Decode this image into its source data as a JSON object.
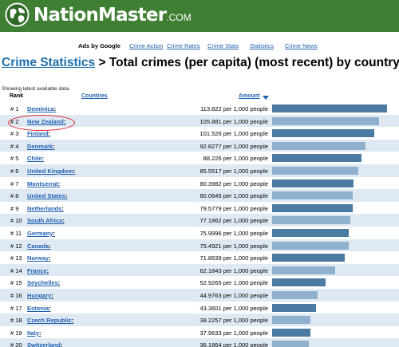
{
  "header": {
    "logo_main": "NationMaster",
    "logo_suffix": ".COM",
    "brand_color": "#3f7f33"
  },
  "adbar": {
    "ads_by": "Ads by Google",
    "links": [
      "Crime Action",
      "Crime Rates",
      "Crime Stats",
      "Statistics",
      "Crime News"
    ]
  },
  "page": {
    "breadcrumb": "Crime Statistics",
    "title": " > Total crimes (per capita) (most recent) by country",
    "showing": "Showing latest available data."
  },
  "table": {
    "headers": {
      "rank": "Rank",
      "countries": "Countries",
      "amount": "Amount"
    },
    "max_value": 113.822,
    "rows": [
      {
        "rank": "# 1",
        "country": "Dominica",
        "amount": "113.822 per 1,000 people",
        "value": 113.822
      },
      {
        "rank": "# 2",
        "country": "New Zealand",
        "amount": "105.881 per 1,000 people",
        "value": 105.881
      },
      {
        "rank": "# 3",
        "country": "Finland",
        "amount": "101.526 per 1,000 people",
        "value": 101.526
      },
      {
        "rank": "# 4",
        "country": "Denmark",
        "amount": "92.8277 per 1,000 people",
        "value": 92.8277
      },
      {
        "rank": "# 5",
        "country": "Chile",
        "amount": "88.226 per 1,000 people",
        "value": 88.226
      },
      {
        "rank": "# 6",
        "country": "United Kingdom",
        "amount": "85.5517 per 1,000 people",
        "value": 85.5517
      },
      {
        "rank": "# 7",
        "country": "Montserrat",
        "amount": "80.3982 per 1,000 people",
        "value": 80.3982
      },
      {
        "rank": "# 8",
        "country": "United States",
        "amount": "80.0645 per 1,000 people",
        "value": 80.0645
      },
      {
        "rank": "# 9",
        "country": "Netherlands",
        "amount": "79.5779 per 1,000 people",
        "value": 79.5779
      },
      {
        "rank": "# 10",
        "country": "South Africa",
        "amount": "77.1862 per 1,000 people",
        "value": 77.1862
      },
      {
        "rank": "# 11",
        "country": "Germany",
        "amount": "75.9996 per 1,000 people",
        "value": 75.9996
      },
      {
        "rank": "# 12",
        "country": "Canada",
        "amount": "75.4921 per 1,000 people",
        "value": 75.4921
      },
      {
        "rank": "# 13",
        "country": "Norway",
        "amount": "71.8639 per 1,000 people",
        "value": 71.8639
      },
      {
        "rank": "# 14",
        "country": "France",
        "amount": "62.1843 per 1,000 people",
        "value": 62.1843
      },
      {
        "rank": "# 15",
        "country": "Seychelles",
        "amount": "52.9265 per 1,000 people",
        "value": 52.9265
      },
      {
        "rank": "# 16",
        "country": "Hungary",
        "amount": "44.9763 per 1,000 people",
        "value": 44.9763
      },
      {
        "rank": "# 17",
        "country": "Estonia",
        "amount": "43.3601 per 1,000 people",
        "value": 43.3601
      },
      {
        "rank": "# 18",
        "country": "Czech Republic",
        "amount": "38.2257 per 1,000 people",
        "value": 38.2257
      },
      {
        "rank": "# 19",
        "country": "Italy",
        "amount": "37.9633 per 1,000 people",
        "value": 37.9633
      },
      {
        "rank": "# 20",
        "country": "Switzerland",
        "amount": "36.1864 per 1,000 people",
        "value": 36.1864
      }
    ]
  },
  "colors": {
    "link": "#1f5fb0",
    "bar_dark": "#4b7ba3",
    "bar_light": "#8fb1cd",
    "row_stripe": "#dfe9f3",
    "highlight": "#e0202c"
  }
}
